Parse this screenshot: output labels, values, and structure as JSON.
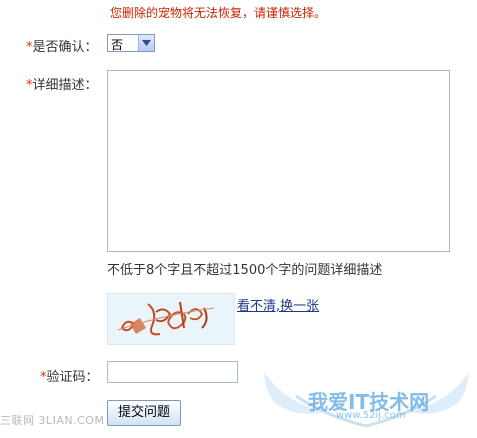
{
  "warning_text": "您删除的宠物将无法恢复，请谨慎选择。",
  "confirm": {
    "required_mark": "*",
    "label": "是否确认：",
    "selected": "否"
  },
  "description": {
    "required_mark": "*",
    "label": "详细描述：",
    "value": "",
    "hint": "不低于8个字且不超过1500个字的问题详细描述"
  },
  "captcha": {
    "refresh_link": "看不清,换一张"
  },
  "code": {
    "required_mark": "*",
    "label": "验证码：",
    "value": ""
  },
  "submit_label": "提交问题",
  "watermark": {
    "left_text": "三联网 3LIAN.COM",
    "logo_text": "我爱IT技术网",
    "logo_url": "www.52ij.com"
  }
}
